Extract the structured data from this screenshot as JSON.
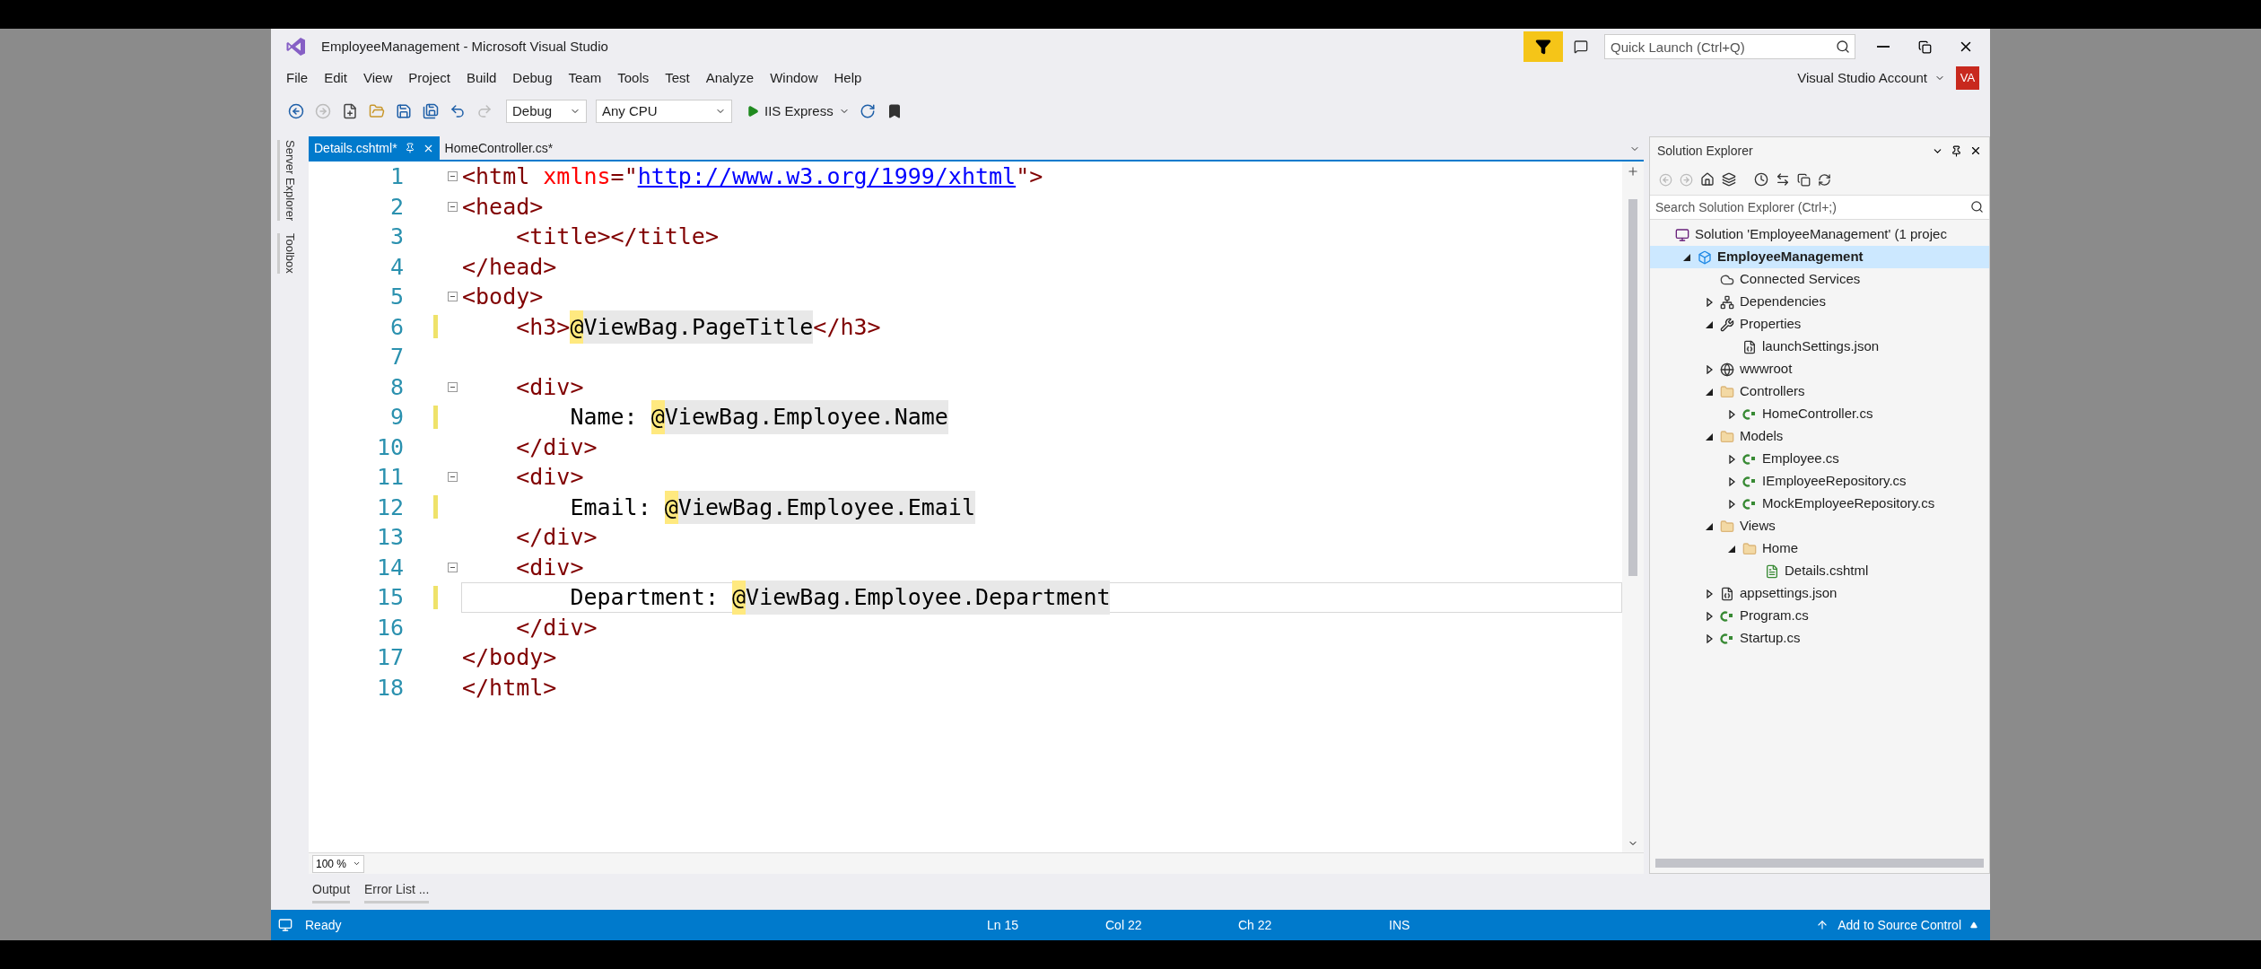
{
  "title_bar": {
    "title": "EmployeeManagement - Microsoft Visual Studio",
    "quick_launch": {
      "placeholder": "Quick Launch (Ctrl+Q)"
    }
  },
  "menu": [
    "File",
    "Edit",
    "View",
    "Project",
    "Build",
    "Debug",
    "Team",
    "Tools",
    "Test",
    "Analyze",
    "Window",
    "Help"
  ],
  "account": {
    "label": "Visual Studio Account",
    "avatar": "VA"
  },
  "toolbar": {
    "configuration": "Debug",
    "platform": "Any CPU",
    "run_target": "IIS Express"
  },
  "side_tabs": [
    "Server Explorer",
    "Toolbox"
  ],
  "editor_tabs": [
    {
      "label": "Details.cshtml*",
      "selected": true
    },
    {
      "label": "HomeController.cs*",
      "selected": false
    }
  ],
  "code_lines": [
    {
      "number": "1",
      "fold": true,
      "changed": false,
      "current": false,
      "tokens": [
        {
          "kind": "tag",
          "text": "<html"
        },
        {
          "kind": "attr",
          "text": " xmlns"
        },
        {
          "kind": "tag",
          "text": "=\""
        },
        {
          "kind": "link",
          "text": "http://www.w3.org/1999/xhtml"
        },
        {
          "kind": "tag",
          "text": "\">"
        }
      ]
    },
    {
      "number": "2",
      "fold": true,
      "changed": false,
      "current": false,
      "tokens": [
        {
          "kind": "tag",
          "text": "<head>"
        }
      ]
    },
    {
      "number": "3",
      "fold": false,
      "changed": false,
      "current": false,
      "tokens": [
        {
          "kind": "tag",
          "text": "    <title></title>"
        }
      ]
    },
    {
      "number": "4",
      "fold": false,
      "changed": false,
      "current": false,
      "tokens": [
        {
          "kind": "tag",
          "text": "</head>"
        }
      ]
    },
    {
      "number": "5",
      "fold": true,
      "changed": false,
      "current": false,
      "tokens": [
        {
          "kind": "tag",
          "text": "<body>"
        }
      ]
    },
    {
      "number": "6",
      "fold": false,
      "changed": true,
      "current": false,
      "tokens": [
        {
          "kind": "tag",
          "text": "    <h3>"
        },
        {
          "kind": "razor-at",
          "text": "@"
        },
        {
          "kind": "razor",
          "text": "ViewBag.PageTitle"
        },
        {
          "kind": "tag",
          "text": "</h3>"
        }
      ]
    },
    {
      "number": "7",
      "fold": false,
      "changed": false,
      "current": false
    },
    {
      "number": "8",
      "fold": true,
      "changed": false,
      "current": false,
      "tokens": [
        {
          "kind": "tag",
          "text": "    <div>"
        }
      ]
    },
    {
      "number": "9",
      "fold": false,
      "changed": true,
      "current": false,
      "tokens": [
        {
          "kind": "text",
          "text": "        Name: "
        },
        {
          "kind": "razor-at",
          "text": "@"
        },
        {
          "kind": "razor",
          "text": "ViewBag.Employee.Name"
        }
      ]
    },
    {
      "number": "10",
      "fold": false,
      "changed": false,
      "current": false,
      "tokens": [
        {
          "kind": "tag",
          "text": "    </div>"
        }
      ]
    },
    {
      "number": "11",
      "fold": true,
      "changed": false,
      "current": false,
      "tokens": [
        {
          "kind": "tag",
          "text": "    <div>"
        }
      ]
    },
    {
      "number": "12",
      "fold": false,
      "changed": true,
      "current": false,
      "tokens": [
        {
          "kind": "text",
          "text": "        Email: "
        },
        {
          "kind": "razor-at",
          "text": "@"
        },
        {
          "kind": "razor",
          "text": "ViewBag.Employee.Email"
        }
      ]
    },
    {
      "number": "13",
      "fold": false,
      "changed": false,
      "current": false,
      "tokens": [
        {
          "kind": "tag",
          "text": "    </div>"
        }
      ]
    },
    {
      "number": "14",
      "fold": true,
      "changed": false,
      "current": false,
      "tokens": [
        {
          "kind": "tag",
          "text": "    <div>"
        }
      ]
    },
    {
      "number": "15",
      "fold": false,
      "changed": true,
      "current": true,
      "tokens": [
        {
          "kind": "text",
          "text": "        Department: "
        },
        {
          "kind": "razor-at",
          "text": "@"
        },
        {
          "kind": "razor",
          "text": "ViewBag.Employee.Department"
        }
      ]
    },
    {
      "number": "16",
      "fold": false,
      "changed": false,
      "current": false,
      "tokens": [
        {
          "kind": "tag",
          "text": "    </div>"
        }
      ]
    },
    {
      "number": "17",
      "fold": false,
      "changed": false,
      "current": false,
      "tokens": [
        {
          "kind": "tag",
          "text": "</body>"
        }
      ]
    },
    {
      "number": "18",
      "fold": false,
      "changed": false,
      "current": false,
      "tokens": [
        {
          "kind": "tag",
          "text": "</html>"
        }
      ]
    }
  ],
  "zoom": "100 %",
  "bottom_tabs": [
    "Output",
    "Error List ..."
  ],
  "solution_explorer": {
    "title": "Solution Explorer",
    "search": {
      "placeholder": "Search Solution Explorer (Ctrl+;)"
    },
    "tree": [
      {
        "label": "Solution 'EmployeeManagement' (1 projec",
        "kind": "solution",
        "selected": false,
        "children": [
          {
            "label": "EmployeeManagement",
            "kind": "project",
            "expanded": true,
            "selected": true,
            "children": [
              {
                "label": "Connected Services",
                "kind": "cloud",
                "selected": false
              },
              {
                "label": "Dependencies",
                "kind": "dependencies",
                "expanded": false,
                "selected": false
              },
              {
                "label": "Properties",
                "kind": "wrench",
                "expanded": true,
                "selected": false,
                "children": [
                  {
                    "label": "launchSettings.json",
                    "kind": "json",
                    "selected": false
                  }
                ]
              },
              {
                "label": "wwwroot",
                "kind": "globe",
                "expanded": false,
                "selected": false
              },
              {
                "label": "Controllers",
                "kind": "folder",
                "expanded": true,
                "selected": false,
                "children": [
                  {
                    "label": "HomeController.cs",
                    "kind": "cs",
                    "expanded": false,
                    "selected": false
                  }
                ]
              },
              {
                "label": "Models",
                "kind": "folder",
                "expanded": true,
                "selected": false,
                "children": [
                  {
                    "label": "Employee.cs",
                    "kind": "cs",
                    "expanded": false,
                    "selected": false
                  },
                  {
                    "label": "IEmployeeRepository.cs",
                    "kind": "cs",
                    "expanded": false,
                    "selected": false
                  },
                  {
                    "label": "MockEmployeeRepository.cs",
                    "kind": "cs",
                    "expanded": false,
                    "selected": false
                  }
                ]
              },
              {
                "label": "Views",
                "kind": "folder",
                "expanded": true,
                "selected": false,
                "children": [
                  {
                    "label": "Home",
                    "kind": "folder",
                    "expanded": true,
                    "selected": false,
                    "children": [
                      {
                        "label": "Details.cshtml",
                        "kind": "page",
                        "selected": false
                      }
                    ]
                  }
                ]
              },
              {
                "label": "appsettings.json",
                "kind": "json",
                "expanded": false,
                "selected": false
              },
              {
                "label": "Program.cs",
                "kind": "cs",
                "expanded": false,
                "selected": false
              },
              {
                "label": "Startup.cs",
                "kind": "cs",
                "expanded": false,
                "selected": false
              }
            ]
          }
        ]
      }
    ]
  },
  "status_bar": {
    "state": "Ready",
    "line": "Ln 15",
    "column": "Col 22",
    "char": "Ch 22",
    "mode": "INS",
    "source_control": "Add to Source Control"
  }
}
